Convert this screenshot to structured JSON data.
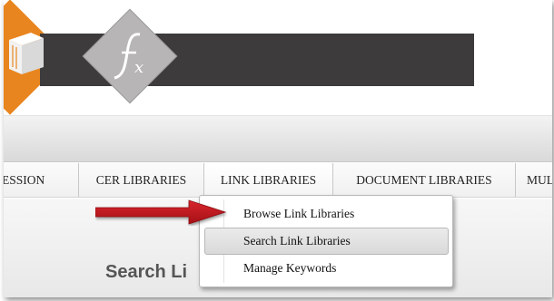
{
  "header": {
    "logo_icons": [
      "book-logo-icon",
      "fx-formula-logo-icon"
    ],
    "brand_colors": {
      "orange": "#e8851e",
      "dark_bar": "#3d3b3c",
      "gray_diamond": "#b7b5b5"
    }
  },
  "nav": {
    "items": [
      {
        "label": "ESSION"
      },
      {
        "label": "CER LIBRARIES"
      },
      {
        "label": "LINK LIBRARIES"
      },
      {
        "label": "DOCUMENT LIBRARIES"
      },
      {
        "label": "MUL"
      }
    ]
  },
  "dropdown": {
    "items": [
      {
        "label": "Browse Link Libraries"
      },
      {
        "label": "Search Link Libraries"
      },
      {
        "label": "Manage Keywords"
      }
    ],
    "highlighted_index": 1
  },
  "page": {
    "title": "Search Li"
  },
  "annotation": {
    "arrow_color": "#c0141b",
    "points_to": "Browse Link Libraries"
  }
}
